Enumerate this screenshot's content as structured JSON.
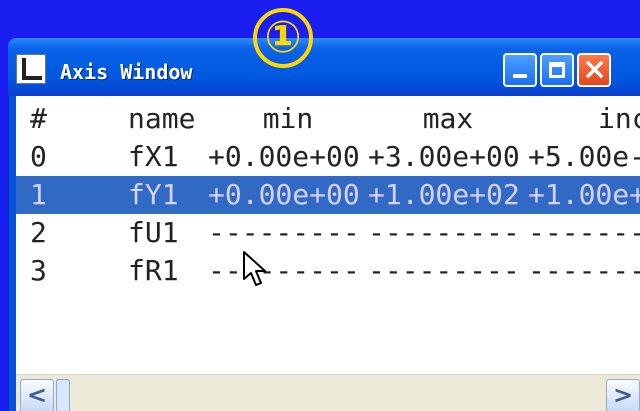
{
  "step_marker": "①",
  "window": {
    "title": "Axis Window",
    "buttons": {
      "minimize_icon": "minimize-icon",
      "maximize_icon": "maximize-icon",
      "close_icon": "close-icon"
    }
  },
  "table": {
    "columns": {
      "index": "#",
      "name": "name",
      "min": "min",
      "max": "max",
      "inc": "inc"
    },
    "rows": [
      {
        "index": "0",
        "name": "fX1",
        "min": "+0.00e+00",
        "max": "+3.00e+00",
        "inc": "+5.00e-"
      },
      {
        "index": "1",
        "name": "fY1",
        "min": "+0.00e+00",
        "max": "+1.00e+02",
        "inc": "+1.00e+"
      },
      {
        "index": "2",
        "name": "fU1",
        "min": "---------",
        "max": "---------",
        "inc": "-------"
      },
      {
        "index": "3",
        "name": "fR1",
        "min": "---------",
        "max": "---------",
        "inc": "-------"
      }
    ],
    "selected_row": "1"
  },
  "scrollbar": {
    "left_arrow": "<",
    "right_arrow": ">"
  },
  "colors": {
    "background": "#1a1ef0",
    "selection": "#316ac5",
    "marker": "#ffd800"
  }
}
